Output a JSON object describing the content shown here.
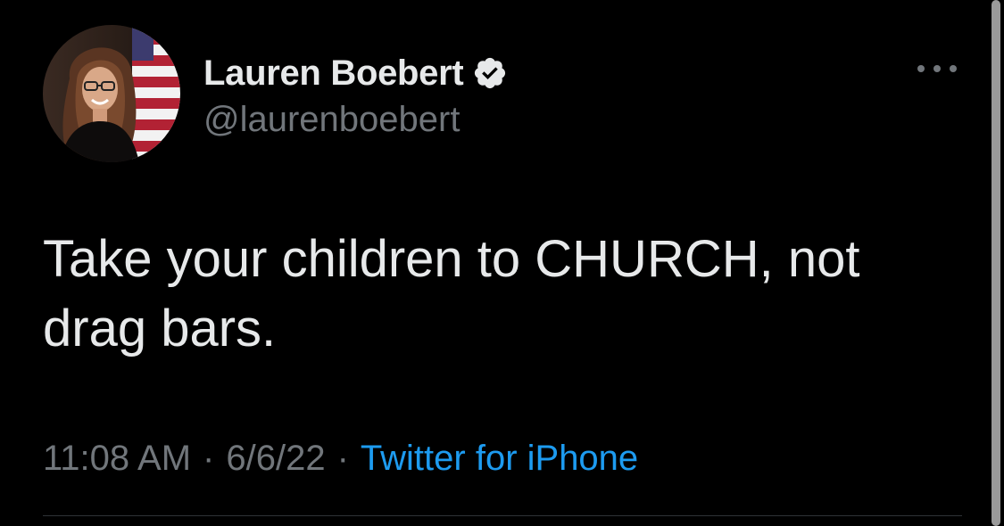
{
  "tweet": {
    "author": {
      "display_name": "Lauren Boebert",
      "handle": "@laurenboebert",
      "verified": true,
      "avatar_icon": "profile-photo"
    },
    "more_icon": "ellipsis-icon",
    "text": "Take your children to CHURCH, not drag bars.",
    "time": "11:08 AM",
    "separator": "·",
    "date": "6/6/22",
    "source": "Twitter for iPhone"
  },
  "colors": {
    "background": "#000000",
    "primary_text": "#e7e9ea",
    "secondary_text": "#71767b",
    "link": "#1d9bf0",
    "divider": "#2f3336"
  }
}
